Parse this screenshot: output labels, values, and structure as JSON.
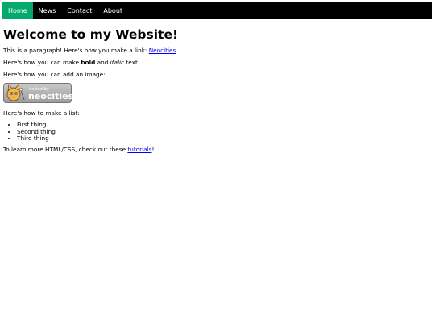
{
  "nav": {
    "items": [
      {
        "label": "Home"
      },
      {
        "label": "News"
      },
      {
        "label": "Contact"
      },
      {
        "label": "About"
      }
    ],
    "active_color": "#04aa6d",
    "bar_color": "#000000"
  },
  "main": {
    "heading": "Welcome to my Website!",
    "p1": {
      "pre": "This is a paragraph! Here's how you make a link: ",
      "link": "Neocities",
      "post": "."
    },
    "p2": {
      "pre": "Here's how you can make ",
      "bold": "bold",
      "mid": " and ",
      "italic": "italic",
      "post": " text."
    },
    "p3": "Here's how you can add an image:",
    "badge": {
      "small_text": "hosted by",
      "big_text": "neocities"
    },
    "p4": "Here's how to make a list:",
    "list": [
      "First thing",
      "Second thing",
      "Third thing"
    ],
    "p5": {
      "pre": "To learn more HTML/CSS, check out these ",
      "link": "tutorials",
      "post": "!"
    }
  }
}
